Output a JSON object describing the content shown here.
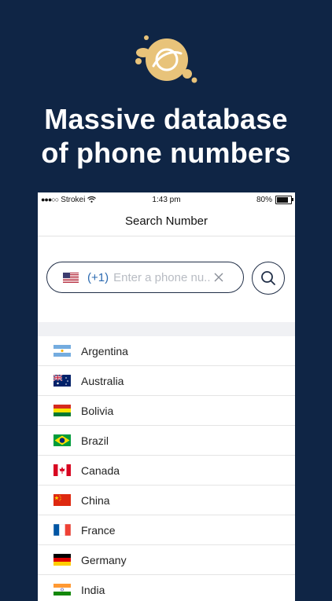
{
  "headline": {
    "line1": "Massive database",
    "line2": "of phone numbers"
  },
  "status_bar": {
    "carrier": "Strokei",
    "time": "1:43 pm",
    "battery": "80%"
  },
  "nav": {
    "title": "Search Number"
  },
  "search": {
    "country_code": "(+1)",
    "placeholder": "Enter a phone nu...",
    "selected_country_flag": "us-flag-icon"
  },
  "countries": [
    {
      "name": "Argentina",
      "flag": "argentina-flag-icon"
    },
    {
      "name": "Australia",
      "flag": "australia-flag-icon"
    },
    {
      "name": "Bolivia",
      "flag": "bolivia-flag-icon"
    },
    {
      "name": "Brazil",
      "flag": "brazil-flag-icon"
    },
    {
      "name": "Canada",
      "flag": "canada-flag-icon"
    },
    {
      "name": "China",
      "flag": "china-flag-icon"
    },
    {
      "name": "France",
      "flag": "france-flag-icon"
    },
    {
      "name": "Germany",
      "flag": "germany-flag-icon"
    },
    {
      "name": "India",
      "flag": "india-flag-icon"
    }
  ],
  "colors": {
    "background": "#0f2545",
    "logo_gold": "#e8c37a",
    "accent_blue": "#2c6ab0",
    "outline": "#1f2d46"
  }
}
